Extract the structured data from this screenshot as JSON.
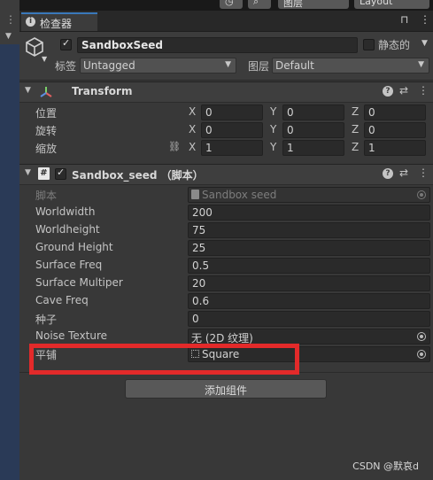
{
  "toolbar": {
    "layers_label": "图层",
    "layout_label": "Layout"
  },
  "tab": {
    "label": "检查器"
  },
  "header": {
    "object_name": "SandboxSeed",
    "active_checked": true,
    "static_label": "静态的",
    "tag_label": "标签",
    "tag_value": "Untagged",
    "layer_label": "图层",
    "layer_value": "Default"
  },
  "transform": {
    "title": "Transform",
    "rows": [
      {
        "label": "位置",
        "x": "0",
        "y": "0",
        "z": "0"
      },
      {
        "label": "旋转",
        "x": "0",
        "y": "0",
        "z": "0"
      },
      {
        "label": "缩放",
        "x": "1",
        "y": "1",
        "z": "1"
      }
    ],
    "axis": {
      "x": "X",
      "y": "Y",
      "z": "Z"
    }
  },
  "script_comp": {
    "title": "Sandbox_seed （脚本）",
    "icon_glyph": "#",
    "script_label": "脚本",
    "script_value": "Sandbox seed",
    "fields": [
      {
        "label": "Worldwidth",
        "value": "200"
      },
      {
        "label": "Worldheight",
        "value": "75"
      },
      {
        "label": "Ground Height",
        "value": "25"
      },
      {
        "label": "Surface Freq",
        "value": "0.5"
      },
      {
        "label": "Surface Multiper",
        "value": "20"
      },
      {
        "label": "Cave Freq",
        "value": "0.6"
      },
      {
        "label": "种子",
        "value": "0"
      }
    ],
    "noise_label": "Noise Texture",
    "noise_value": "无 (2D 纹理)",
    "tile_label": "平铺",
    "tile_value": "Square"
  },
  "add_component_label": "添加组件",
  "watermark": "CSDN @默哀d",
  "colors": {
    "highlight": "#e32a2a",
    "tab_accent": "#3a79bb"
  }
}
